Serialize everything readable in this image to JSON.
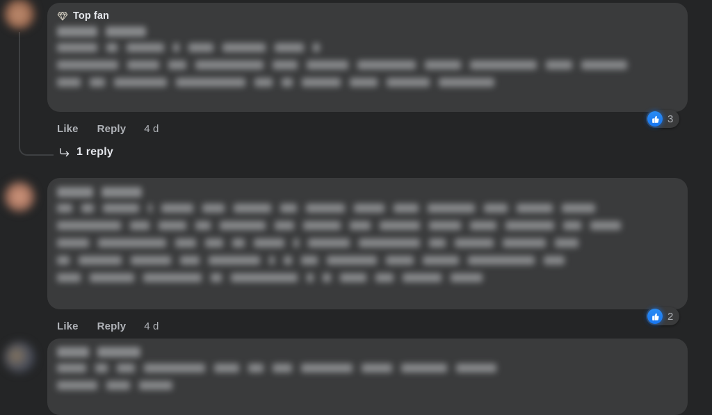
{
  "theme": {
    "page_background": "#242526",
    "bubble_background": "#3a3b3c",
    "primary_text": "#e4e6eb",
    "secondary_text": "#b0b3b8",
    "reaction_blue": "#1877f2",
    "thread_line": "#3e4042"
  },
  "comments": [
    {
      "id": "comment-1",
      "badge": {
        "icon": "diamond-icon",
        "label": "Top fan"
      },
      "author_name_redacted": true,
      "body_redacted": true,
      "body_line_count": 3,
      "actions": {
        "like_label": "Like",
        "reply_label": "Reply",
        "timestamp": "4 d"
      },
      "reaction": {
        "icon": "thumbs-up-icon",
        "count": "3"
      },
      "replies": {
        "icon": "reply-arrow-icon",
        "label": "1 reply"
      }
    },
    {
      "id": "comment-2",
      "author_name_redacted": true,
      "body_redacted": true,
      "body_line_count": 5,
      "actions": {
        "like_label": "Like",
        "reply_label": "Reply",
        "timestamp": "4 d"
      },
      "reaction": {
        "icon": "thumbs-up-icon",
        "count": "2"
      }
    },
    {
      "id": "comment-3",
      "author_name_redacted": true,
      "body_redacted": true,
      "body_line_count": 2
    }
  ]
}
